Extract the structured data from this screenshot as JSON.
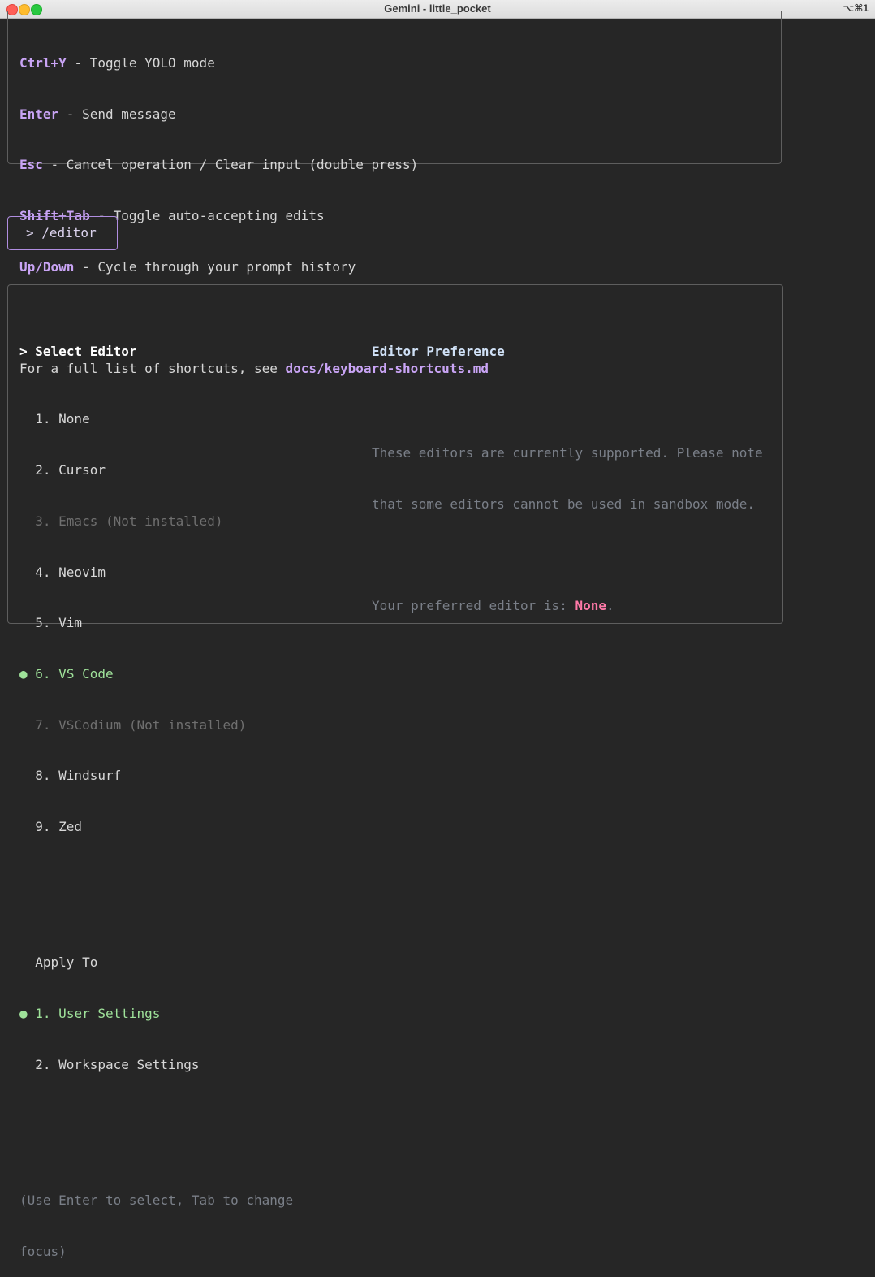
{
  "window": {
    "title": "Gemini - little_pocket",
    "shortcut": "⌥⌘1"
  },
  "help": {
    "shortcuts": [
      {
        "key": "Ctrl+Y",
        "desc": " - Toggle YOLO mode"
      },
      {
        "key": "Enter",
        "desc": " - Send message"
      },
      {
        "key": "Esc",
        "desc": " - Cancel operation / Clear input (double press)"
      },
      {
        "key": "Shift+Tab",
        "desc": " - Toggle auto-accepting edits"
      },
      {
        "key": "Up/Down",
        "desc": " - Cycle through your prompt history"
      }
    ],
    "footer_prefix": "For a full list of shortcuts, see ",
    "footer_path": "docs/keyboard-shortcuts.md"
  },
  "prompt": {
    "text": "> /editor"
  },
  "editor_dialog": {
    "select_heading": "Select Editor",
    "focus_marker": ">",
    "editors": [
      {
        "label": "1. None",
        "state": "normal"
      },
      {
        "label": "2. Cursor",
        "state": "normal"
      },
      {
        "label": "3. Emacs (Not installed)",
        "state": "disabled"
      },
      {
        "label": "4. Neovim",
        "state": "normal"
      },
      {
        "label": "5. Vim",
        "state": "normal"
      },
      {
        "label": "6. VS Code",
        "state": "active"
      },
      {
        "label": "7. VSCodium (Not installed)",
        "state": "disabled"
      },
      {
        "label": "8. Windsurf",
        "state": "normal"
      },
      {
        "label": "9. Zed",
        "state": "normal"
      }
    ],
    "apply_heading": "Apply To",
    "scopes": [
      {
        "label": "1. User Settings",
        "state": "active"
      },
      {
        "label": "2. Workspace Settings",
        "state": "normal"
      }
    ],
    "bullet": "●",
    "hint_line1": "(Use Enter to select, Tab to change",
    "hint_line2": "focus)",
    "preference": {
      "title": "Editor Preference",
      "desc_line1": "These editors are currently supported. Please note",
      "desc_line2": "that some editors cannot be used in sandbox mode.",
      "current_prefix": "Your preferred editor is: ",
      "current_value": "None",
      "current_suffix": "."
    }
  },
  "colors": {
    "accent": "#c9a4f5",
    "active": "#9fe29a",
    "value": "#ff79a8",
    "background": "#262626"
  }
}
